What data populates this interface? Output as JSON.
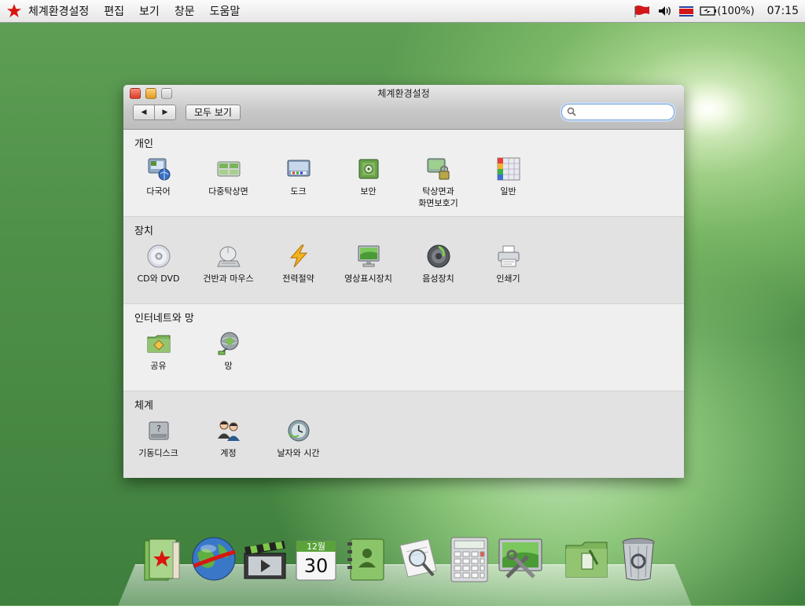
{
  "menubar": {
    "app_name": "체계환경설정",
    "items": [
      "편집",
      "보기",
      "창문",
      "도움말"
    ],
    "battery": "(100%)",
    "clock": "07:15"
  },
  "window": {
    "title": "체계환경설정",
    "back_label": "◀",
    "forward_label": "▶",
    "show_all_label": "모두 보기",
    "search": {
      "value": "",
      "placeholder": ""
    }
  },
  "sections": [
    {
      "title": "개인",
      "items": [
        {
          "label": "다국어",
          "icon": "globe-flag-icon"
        },
        {
          "label": "다중탁상면",
          "icon": "multi-desktop-icon"
        },
        {
          "label": "도크",
          "icon": "dock-icon"
        },
        {
          "label": "보안",
          "icon": "safe-icon"
        },
        {
          "label": "탁상면과\n화면보호기",
          "icon": "desktop-lock-icon"
        },
        {
          "label": "일반",
          "icon": "color-grid-icon"
        }
      ]
    },
    {
      "title": "장치",
      "items": [
        {
          "label": "CD와 DVD",
          "icon": "disc-icon"
        },
        {
          "label": "건반과 마우스",
          "icon": "mouse-icon"
        },
        {
          "label": "전력절약",
          "icon": "lightning-icon"
        },
        {
          "label": "영상표시장치",
          "icon": "monitor-icon"
        },
        {
          "label": "음성장치",
          "icon": "speaker-icon"
        },
        {
          "label": "인쇄기",
          "icon": "printer-icon"
        }
      ]
    },
    {
      "title": "인터네트와 망",
      "items": [
        {
          "label": "공유",
          "icon": "shared-folder-icon"
        },
        {
          "label": "망",
          "icon": "network-globe-icon"
        }
      ]
    },
    {
      "title": "체계",
      "items": [
        {
          "label": "기동디스크",
          "icon": "startup-disk-icon"
        },
        {
          "label": "계정",
          "icon": "accounts-icon"
        },
        {
          "label": "날자와 시간",
          "icon": "clock-globe-icon"
        }
      ]
    }
  ],
  "dock": {
    "items": [
      {
        "icon": "red-star-book-icon"
      },
      {
        "icon": "globe-browser-icon"
      },
      {
        "icon": "clapperboard-icon"
      },
      {
        "icon": "calendar-icon",
        "month": "12월",
        "day": "30"
      },
      {
        "icon": "address-book-icon"
      },
      {
        "icon": "document-magnifier-icon"
      },
      {
        "icon": "calculator-icon"
      },
      {
        "icon": "system-preferences-icon"
      },
      {
        "icon": "folder-icon"
      },
      {
        "icon": "trash-icon"
      }
    ]
  },
  "colors": {
    "desktop_green": "#4f9049",
    "window_bg": "#ececec",
    "close_red": "#d83a26",
    "minimize_orange": "#e09a1f",
    "search_focus": "#7ea6d6"
  }
}
